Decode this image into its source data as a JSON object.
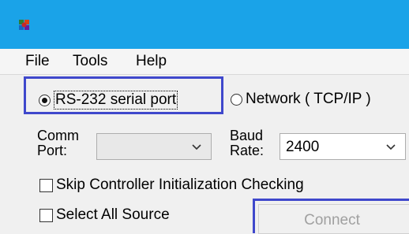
{
  "app": {
    "icon": "app-logo-icon",
    "title_bar_color": "#1aa3e8"
  },
  "menu": {
    "items": [
      {
        "label": "File"
      },
      {
        "label": "Tools"
      },
      {
        "label": "Help"
      }
    ]
  },
  "connection_type": {
    "options": [
      {
        "label": "RS-232 serial port",
        "selected": true
      },
      {
        "label": "Network ( TCP/IP )",
        "selected": false
      }
    ],
    "highlight_color": "#3f48cc"
  },
  "comm_port": {
    "label": "Comm\nPort:",
    "value": ""
  },
  "baud_rate": {
    "label": "Baud\nRate:",
    "value": "2400"
  },
  "options": {
    "skip_check": {
      "label": "Skip Controller Initialization Checking",
      "checked": false
    },
    "select_all": {
      "label": "Select All Source",
      "checked": false
    }
  },
  "connect_button": {
    "label": "Connect",
    "enabled": false
  }
}
